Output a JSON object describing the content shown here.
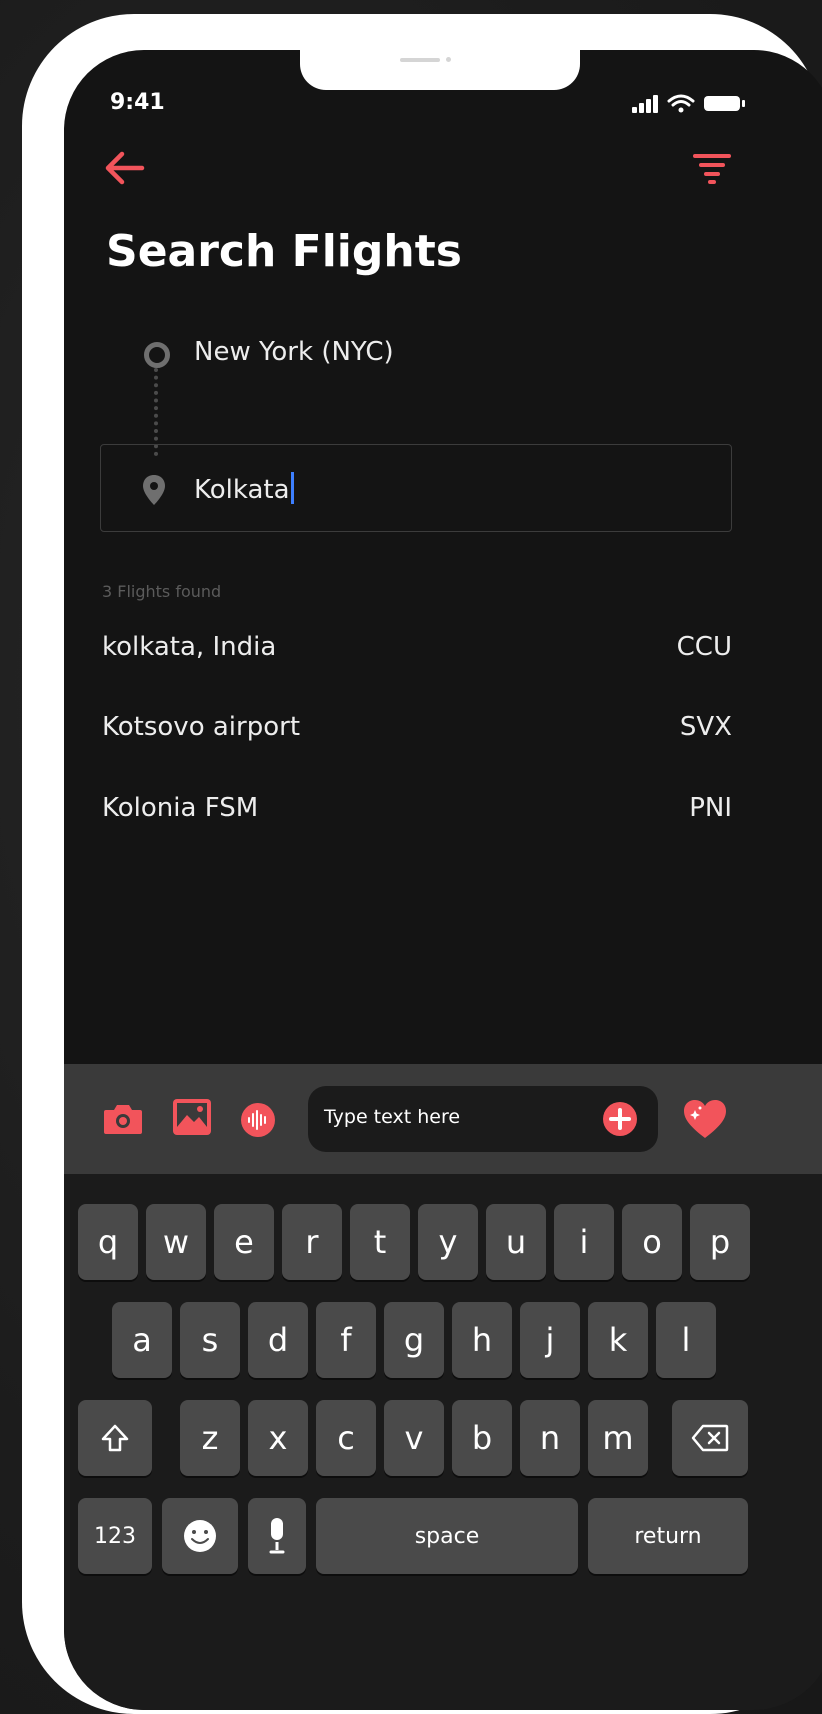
{
  "status_bar": {
    "time": "9:41",
    "icons": [
      "signal-icon",
      "wifi-icon",
      "battery-icon"
    ]
  },
  "header": {
    "back_icon": "arrow-left-icon",
    "filter_icon": "filter-funnel-icon",
    "title": "Search Flights"
  },
  "search": {
    "origin": "New York (NYC)",
    "destination": "Kolkata",
    "origin_icon": "circle-icon",
    "destination_icon": "map-pin-icon"
  },
  "results": {
    "count_text": "3 Flights found",
    "items": [
      {
        "name": "kolkata, India",
        "code": "CCU"
      },
      {
        "name": "Kotsovo airport",
        "code": "SVX"
      },
      {
        "name": "Kolonia FSM",
        "code": "PNI"
      }
    ]
  },
  "toolbar": {
    "placeholder": "Type text here",
    "icons": [
      "camera-icon",
      "image-icon",
      "audio-icon",
      "plus-icon",
      "heart-icon"
    ]
  },
  "keyboard": {
    "row1": [
      "q",
      "w",
      "e",
      "r",
      "t",
      "y",
      "u",
      "i",
      "o",
      "p"
    ],
    "row2": [
      "a",
      "s",
      "d",
      "f",
      "g",
      "h",
      "j",
      "k",
      "l"
    ],
    "row3": [
      "z",
      "x",
      "c",
      "v",
      "b",
      "n",
      "m"
    ],
    "numbers_key": "123",
    "space_key": "space",
    "return_key": "return"
  },
  "colors": {
    "accent": "#f2545b",
    "background": "#141414",
    "text": "#ededed"
  }
}
